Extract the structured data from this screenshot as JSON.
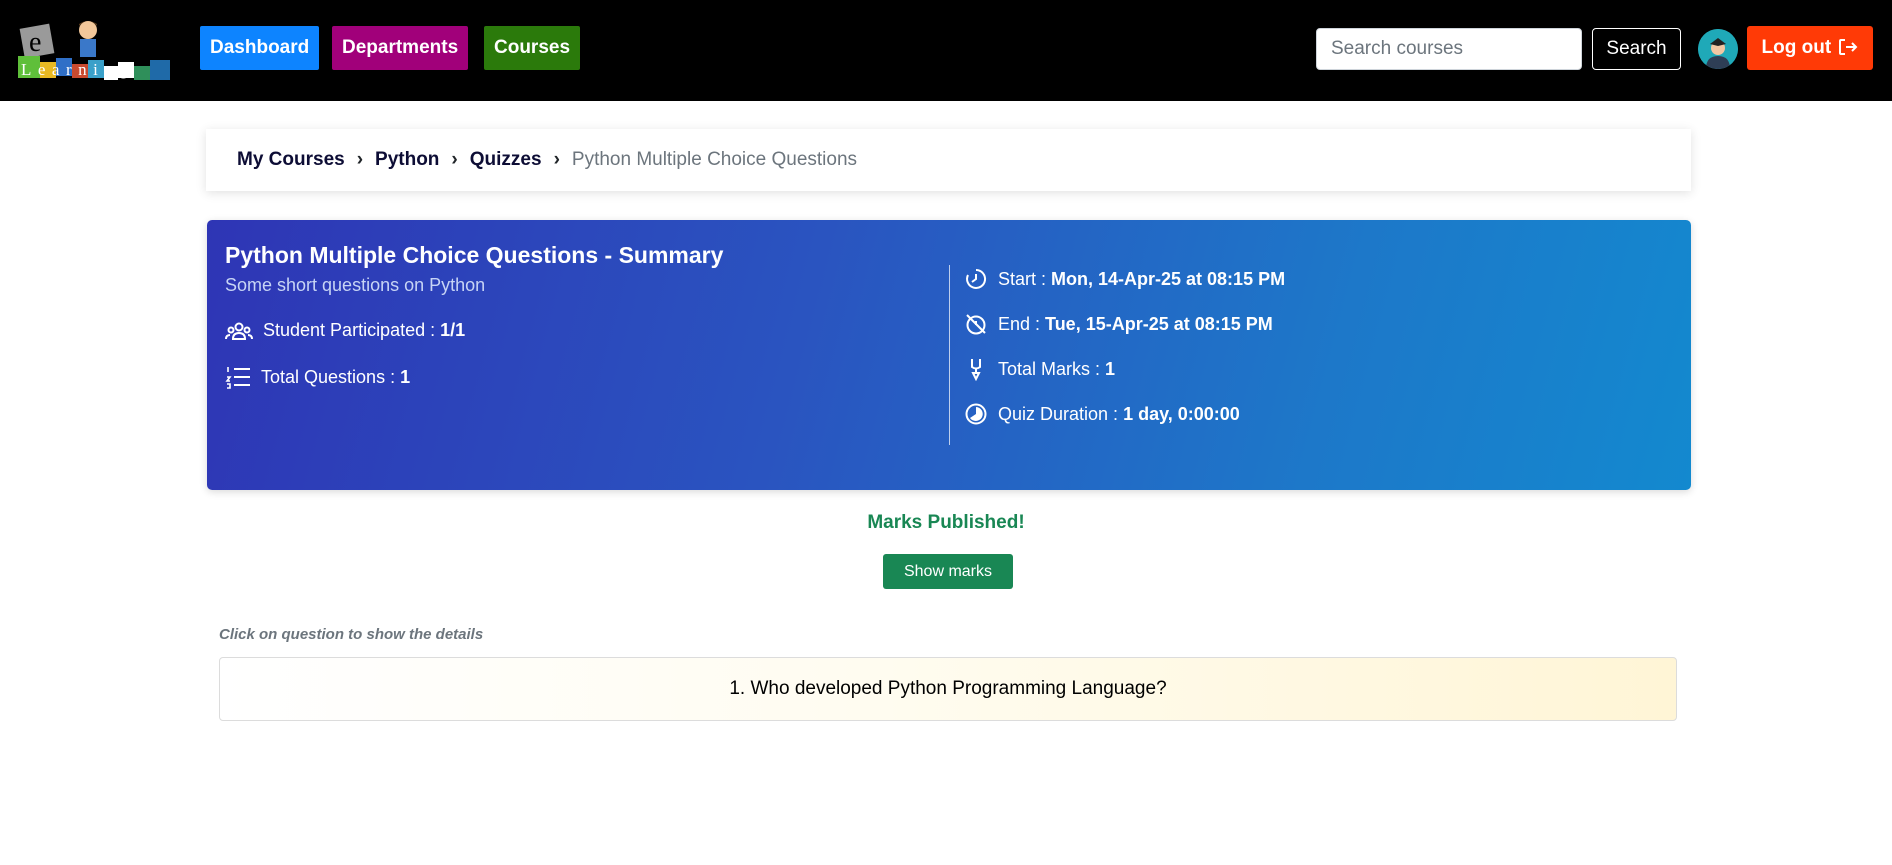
{
  "logo": {
    "text_e": "e",
    "text_learning": "Learning"
  },
  "nav": {
    "dashboard": {
      "label": "Dashboard",
      "color": "#0d84ff"
    },
    "departments": {
      "label": "Departments",
      "color": "#a1007a"
    },
    "courses": {
      "label": "Courses",
      "color": "#2b7a0b"
    }
  },
  "search": {
    "placeholder": "Search courses",
    "button_label": "Search"
  },
  "logout": {
    "label": "Log out",
    "color": "#ff3a06"
  },
  "breadcrumb": {
    "items": [
      "My Courses",
      "Python",
      "Quizzes"
    ],
    "separator": "›",
    "active": "Python Multiple Choice Questions"
  },
  "summary": {
    "title": "Python Multiple Choice Questions - Summary",
    "subtitle": "Some short questions on Python",
    "participated_label": "Student Participated :",
    "participated_value": "1/1",
    "total_questions_label": "Total Questions :",
    "total_questions_value": "1",
    "start_label": "Start :",
    "start_value": "Mon, 14-Apr-25 at 08:15 PM",
    "end_label": "End :",
    "end_value": "Tue, 15-Apr-25 at 08:15 PM",
    "total_marks_label": "Total Marks :",
    "total_marks_value": "1",
    "duration_label": "Quiz Duration :",
    "duration_value": "1 day, 0:00:00"
  },
  "marks": {
    "status": "Marks Published!",
    "button_label": "Show marks"
  },
  "questions": {
    "hint": "Click on question to show the details",
    "items": [
      "1. Who developed Python Programming Language?"
    ]
  }
}
